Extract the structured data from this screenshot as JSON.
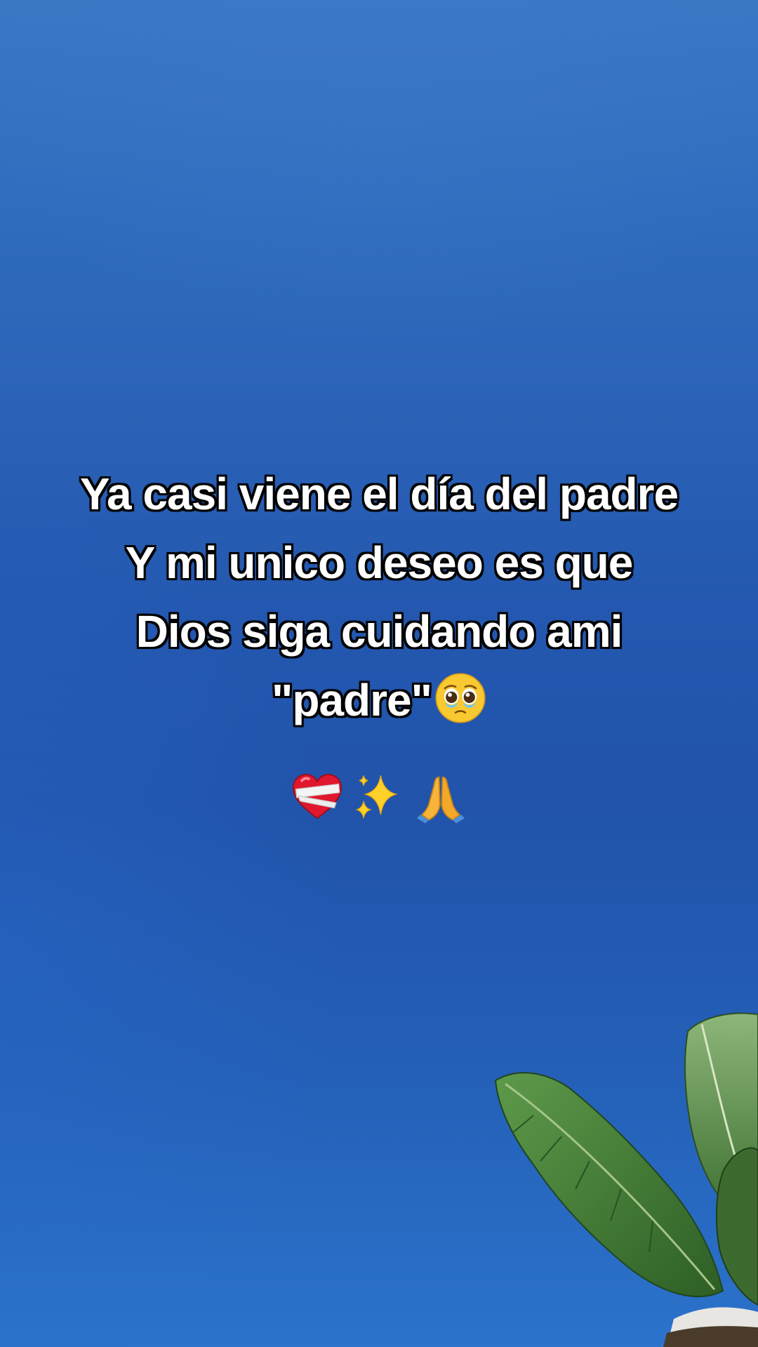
{
  "caption": {
    "lines": [
      "Ya casi viene el día del padre",
      "Y mi unico deseo es que",
      "Dios siga cuidando ami",
      "\"padre\""
    ]
  },
  "icons": {
    "caption_end": "pleading-teary-face-icon",
    "row": [
      "mending-heart-icon",
      "sparkles-icon",
      "praying-hands-icon"
    ]
  },
  "colors": {
    "sky_top": "#3a78c4",
    "sky_mid": "#2153aa",
    "sky_bottom": "#2b73cc",
    "text": "#ffffff",
    "text_outline": "#000000",
    "leaf": "#3f7a34"
  }
}
